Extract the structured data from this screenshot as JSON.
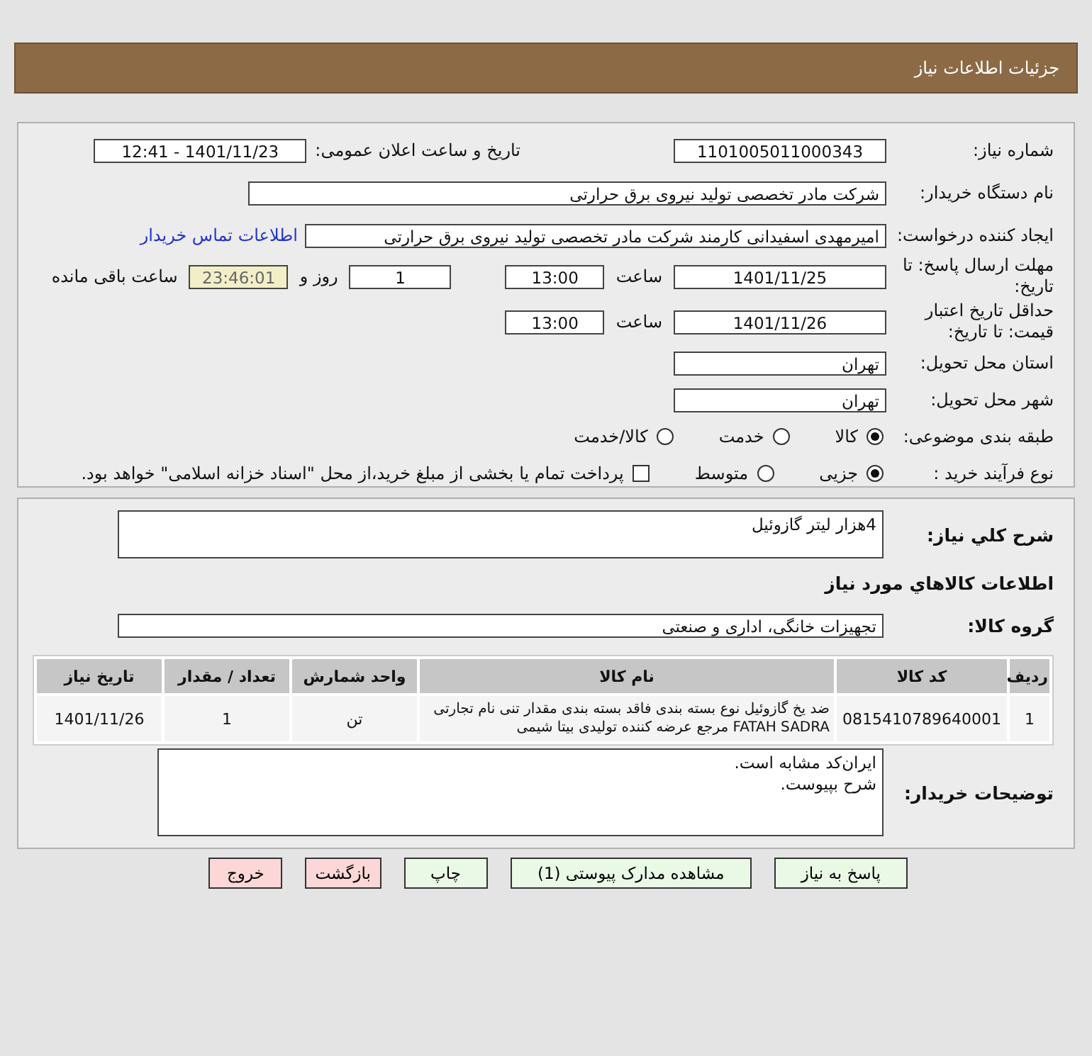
{
  "header": {
    "title": "جزئیات اطلاعات نیاز"
  },
  "need_number": {
    "label": "شماره نیاز:",
    "value": "1101005011000343"
  },
  "announce": {
    "label": "تاریخ و ساعت اعلان عمومی:",
    "value": "1401/11/23 - 12:41"
  },
  "buyer_org": {
    "label": "نام دستگاه خریدار:",
    "value": "شرکت مادر تخصصی تولید نیروی برق حرارتی"
  },
  "requester": {
    "label": "ایجاد کننده درخواست:",
    "value": "امیرمهدی اسفیدانی کارمند شرکت مادر تخصصی تولید نیروی برق حرارتی",
    "link": "اطلاعات تماس خریدار"
  },
  "response_deadline": {
    "label": "مهلت ارسال پاسخ: تا تاریخ:",
    "date": "1401/11/25",
    "time_label": "ساعت",
    "time": "13:00",
    "days": "1",
    "days_label": "روز و",
    "remaining": "23:46:01",
    "remaining_label": "ساعت باقی مانده"
  },
  "price_validity": {
    "label": "حداقل تاریخ اعتبار قیمت: تا تاریخ:",
    "date": "1401/11/26",
    "time_label": "ساعت",
    "time": "13:00"
  },
  "province": {
    "label": "استان محل تحویل:",
    "value": "تهران"
  },
  "city": {
    "label": "شهر محل تحویل:",
    "value": "تهران"
  },
  "category": {
    "label": "طبقه بندی موضوعی:",
    "options": [
      {
        "label": "کالا",
        "selected": true
      },
      {
        "label": "خدمت",
        "selected": false
      },
      {
        "label": "کالا/خدمت",
        "selected": false
      }
    ]
  },
  "process": {
    "label": "نوع فرآیند خرید :",
    "options": [
      {
        "label": "جزیی",
        "selected": true
      },
      {
        "label": "متوسط",
        "selected": false
      }
    ],
    "payment": {
      "label": "پرداخت تمام یا بخشی از مبلغ خرید،از محل \"اسناد خزانه اسلامی\" خواهد بود.",
      "checked": false
    }
  },
  "summary": {
    "label": "شرح كلي نياز:",
    "value": "4هزار لیتر گازوئیل"
  },
  "goods_heading": "اطلاعات كالاهاي مورد نياز",
  "goods_group": {
    "label": "گروه کالا:",
    "value": "تجهیزات خانگی، اداری و صنعتی"
  },
  "table": {
    "columns": [
      "ردیف",
      "کد کالا",
      "نام کالا",
      "واحد شمارش",
      "تعداد / مقدار",
      "تاریخ نیاز"
    ],
    "rows": [
      {
        "cells": [
          "1",
          "0815410789640001",
          "ضد یخ گازوئیل نوع بسته بندی فاقد بسته بندی مقدار تنی نام تجارتی FATAH SADRA مرجع عرضه کننده تولیدی بیتا شیمی",
          "تن",
          "1",
          "1401/11/26"
        ]
      }
    ]
  },
  "buyer_notes": {
    "label": "توضیحات خریدار:",
    "value": "ایران‌کد مشابه است.\nشرح بپیوست."
  },
  "buttons": [
    {
      "label": "پاسخ به نیاز",
      "kind": "normal"
    },
    {
      "label": "مشاهده مدارک پیوستی (1)",
      "kind": "normal"
    },
    {
      "label": "چاپ",
      "kind": "normal"
    },
    {
      "label": "بازگشت",
      "kind": "danger"
    },
    {
      "label": "خروج",
      "kind": "danger"
    }
  ]
}
